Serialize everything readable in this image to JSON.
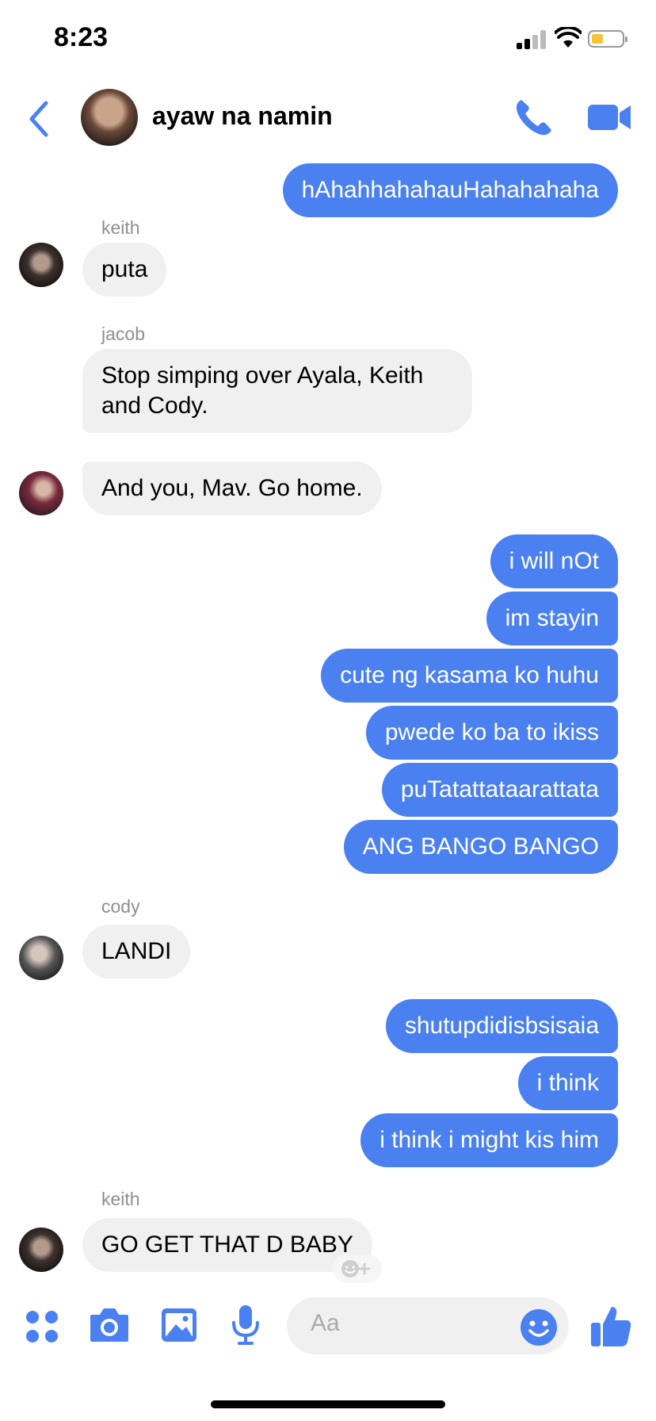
{
  "status": {
    "time": "8:23"
  },
  "header": {
    "title": "ayaw na namin"
  },
  "messages": [
    {
      "type": "out",
      "text": "hAhahhahahauHahahahaha"
    },
    {
      "type": "sender",
      "text": "keith"
    },
    {
      "type": "in",
      "text": "puta"
    },
    {
      "type": "sender",
      "text": "jacob"
    },
    {
      "type": "in",
      "text": "Stop simping over Ayala, Keith and Cody."
    },
    {
      "type": "in",
      "text": "And you, Mav. Go home."
    },
    {
      "type": "out",
      "text": "i will nOt"
    },
    {
      "type": "out",
      "text": "im stayin"
    },
    {
      "type": "out",
      "text": "cute ng kasama ko huhu"
    },
    {
      "type": "out",
      "text": "pwede ko ba to ikiss"
    },
    {
      "type": "out",
      "text": "puTatattataarattata"
    },
    {
      "type": "out",
      "text": "ANG BANGO BANGO"
    },
    {
      "type": "sender",
      "text": "cody"
    },
    {
      "type": "in",
      "text": "LANDI"
    },
    {
      "type": "out",
      "text": "shutupdidisbsisaia"
    },
    {
      "type": "out",
      "text": "i think"
    },
    {
      "type": "out",
      "text": "i think i might kis him"
    },
    {
      "type": "sender",
      "text": "keith"
    },
    {
      "type": "in",
      "text": "GO GET THAT D BABY"
    }
  ],
  "composer": {
    "placeholder": "Aa"
  },
  "colors": {
    "accent": "#4a80f0",
    "incoming": "#f0f0f0"
  },
  "icons": [
    "apps-icon",
    "camera-icon",
    "gallery-icon",
    "microphone-icon",
    "emoji-icon",
    "like-icon",
    "phone-icon",
    "video-icon",
    "back-icon"
  ]
}
